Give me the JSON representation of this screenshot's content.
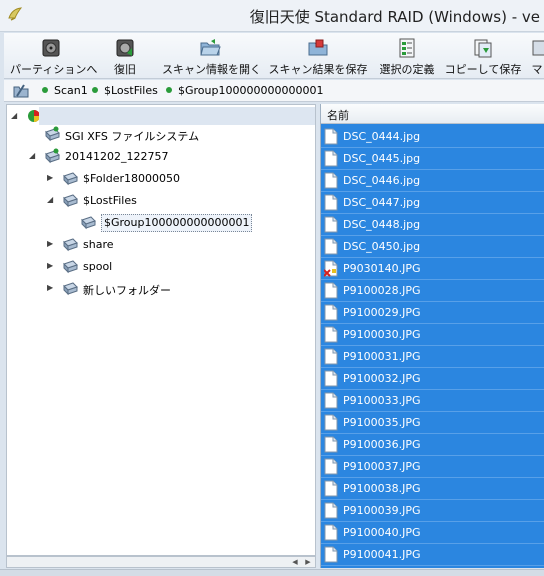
{
  "window": {
    "title": "復旧天使 Standard RAID (Windows) - ve"
  },
  "toolbar": [
    {
      "label": "パーティションへ",
      "icon": "disk-icon"
    },
    {
      "label": "復旧",
      "icon": "disk-recover-icon"
    },
    {
      "label": "スキャン情報を開く",
      "icon": "folder-open-icon"
    },
    {
      "label": "スキャン結果を保存",
      "icon": "folder-save-icon"
    },
    {
      "label": "選択の定義",
      "icon": "select-define-icon"
    },
    {
      "label": "コピーして保存",
      "icon": "copy-save-icon"
    },
    {
      "label": "マ",
      "icon": "more-icon"
    }
  ],
  "breadcrumb": [
    "Scan1",
    "$LostFiles",
    "$Group100000000000001"
  ],
  "tree": {
    "nodes": [
      {
        "label": "SGI XFS ファイルシステム",
        "expanded": false
      },
      {
        "label": "20141202_122757",
        "expanded": true
      },
      {
        "label": "$Folder18000050",
        "expanded": false
      },
      {
        "label": "$LostFiles",
        "expanded": true
      },
      {
        "label": "$Group100000000000001",
        "selected": true
      },
      {
        "label": "share",
        "expanded": false
      },
      {
        "label": "spool",
        "expanded": false
      },
      {
        "label": "新しいフォルダー",
        "expanded": false
      }
    ]
  },
  "list": {
    "header": "名前",
    "files": [
      "DSC_0444.jpg",
      "DSC_0445.jpg",
      "DSC_0446.jpg",
      "DSC_0447.jpg",
      "DSC_0448.jpg",
      "DSC_0450.jpg",
      "P9030140.JPG",
      "P9100028.JPG",
      "P9100029.JPG",
      "P9100030.JPG",
      "P9100031.JPG",
      "P9100032.JPG",
      "P9100033.JPG",
      "P9100035.JPG",
      "P9100036.JPG",
      "P9100037.JPG",
      "P9100038.JPG",
      "P9100039.JPG",
      "P9100040.JPG",
      "P9100041.JPG"
    ],
    "damaged_index": 6
  },
  "colors": {
    "selection": "#2b86e0",
    "accent_green": "#2a9b3a",
    "damaged_mark": "#d62020"
  }
}
